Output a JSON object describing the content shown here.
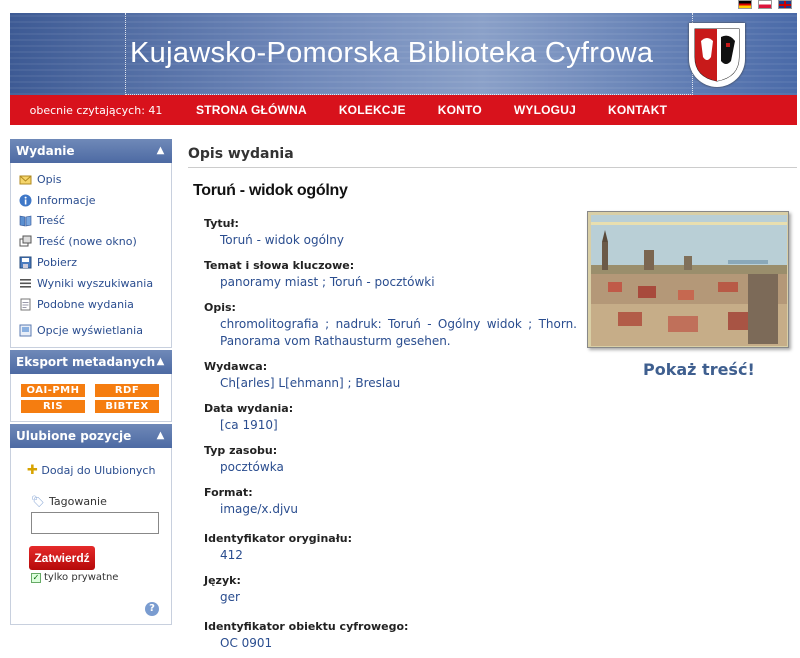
{
  "header": {
    "title": "Kujawsko-Pomorska Biblioteka Cyfrowa",
    "flags": [
      "de-flag",
      "pl-flag",
      "en-flag"
    ]
  },
  "nav": {
    "readers": "obecnie czytających: 41",
    "items": [
      "STRONA GŁÓWNA",
      "KOLEKCJE",
      "KONTO",
      "WYLOGUJ",
      "KONTAKT"
    ]
  },
  "sidebar": {
    "edition": {
      "title": "Wydanie",
      "links": [
        "Opis",
        "Informacje",
        "Treść",
        "Treść (nowe okno)",
        "Pobierz",
        "Wyniki wyszukiwania",
        "Podobne wydania",
        "Opcje wyświetlania"
      ]
    },
    "export": {
      "title": "Eksport metadanych",
      "buttons": [
        "OAI-PMH",
        "RDF",
        "RIS",
        "BIBTEX"
      ]
    },
    "favorites": {
      "title": "Ulubione pozycje",
      "add": "Dodaj do Ulubionych",
      "tag_label": "Tagowanie",
      "tag_value": "",
      "submit": "Zatwierdź",
      "private_label": "tylko prywatne",
      "help": "?"
    }
  },
  "main": {
    "section_title": "Opis wydania",
    "pub_title": "Toruń - widok ogólny",
    "show_content": "Pokaż treść!",
    "fields": [
      {
        "label": "Tytuł:",
        "value": "Toruń - widok ogólny"
      },
      {
        "label": "Temat i słowa kluczowe:",
        "value": "panoramy miast ; Toruń - pocztówki"
      },
      {
        "label": "Opis:",
        "value": "chromolitografia ; nadruk: Toruń - Ogólny widok ; Thorn. Panorama vom Rathausturm gesehen."
      },
      {
        "label": "Wydawca:",
        "value": "Ch[arles] L[ehmann] ; Breslau"
      },
      {
        "label": "Data wydania:",
        "value": "[ca 1910]"
      },
      {
        "label": "Typ zasobu:",
        "value": "pocztówka"
      },
      {
        "label": "Format:",
        "value": "image/x.djvu"
      },
      {
        "label": "Identyfikator oryginału:",
        "value": "412"
      },
      {
        "label": "Język:",
        "value": "ger"
      },
      {
        "label": "Identyfikator obiektu cyfrowego:",
        "value": "OC 0901"
      }
    ]
  },
  "colors": {
    "nav_red": "#d8121c",
    "sidebar_head": "#5a76ab",
    "link_blue": "#2a4d8f",
    "export_orange": "#f57d10",
    "submit_red": "#c8141a"
  }
}
